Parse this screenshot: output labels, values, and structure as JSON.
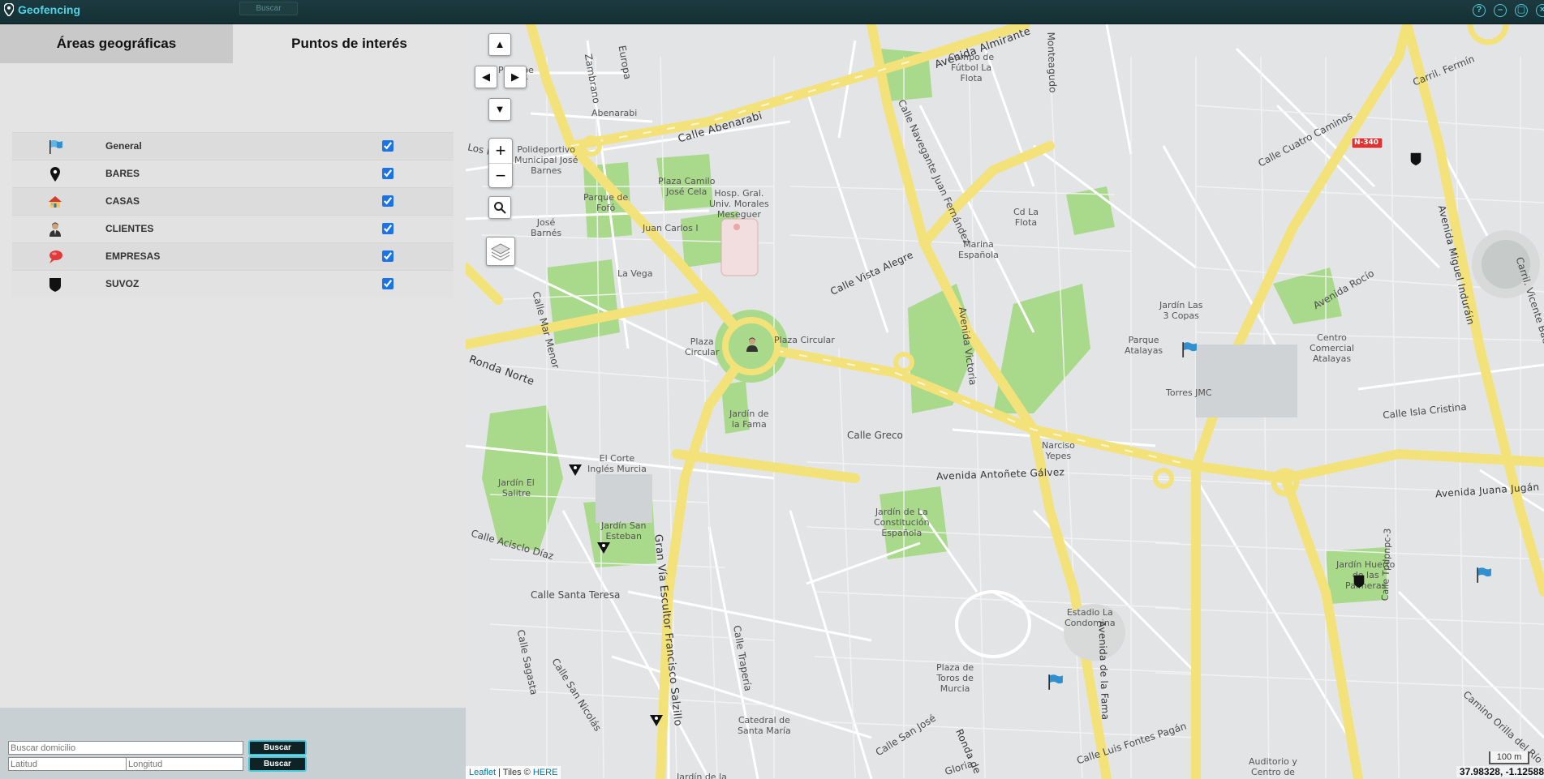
{
  "window": {
    "title": "Geofencing",
    "ghost_search_label": "Buscar",
    "controls": [
      "help-icon",
      "minimize-icon",
      "maximize-icon",
      "close-icon"
    ]
  },
  "tabs": [
    {
      "label": "Áreas geográficas",
      "active": false
    },
    {
      "label": "Puntos de interés",
      "active": true
    }
  ],
  "poi_categories": [
    {
      "label": "General",
      "icon": "blue-flag-icon",
      "checked": true
    },
    {
      "label": "BARES",
      "icon": "black-pin-icon",
      "checked": true
    },
    {
      "label": "CASAS",
      "icon": "house-icon",
      "checked": true
    },
    {
      "label": "CLIENTES",
      "icon": "person-icon",
      "checked": true
    },
    {
      "label": "EMPRESAS",
      "icon": "red-speech-bubble-icon",
      "checked": true
    },
    {
      "label": "SUVOZ",
      "icon": "black-shield-icon",
      "checked": true
    }
  ],
  "search": {
    "address_placeholder": "Buscar domicilio",
    "lat_placeholder": "Latitud",
    "lng_placeholder": "Longitud",
    "button_label": "Buscar"
  },
  "map": {
    "attribution_leaflet": "Leaflet",
    "attribution_tiles": " | Tiles © ",
    "attribution_provider": "HERE",
    "scale_label": "100 m",
    "coordinates": "37.98328, -1.12588",
    "shield_label": "N-340",
    "labels": {
      "avenida_almirante": "Avenida Almirante",
      "calle_abenarabi": "Calle Abenarabi",
      "abenarabi": "Abenarabi",
      "campo_futbol": "Campo de\nFútbol La\nFlota",
      "polideportivo": "Polideportivo\nMunicipal José\nBarnes",
      "parque_fofo": "Parque de\nFofó",
      "plaza_camilo": "Plaza Camilo\nJosé Cela",
      "hosp": "Hosp. Gral.\nUniv. Morales\nMeseguer",
      "jose_barnes": "José\nBarnés",
      "juan_carlos": "Juan Carlos I",
      "la_vega": "La Vega",
      "calle_vista_alegre": "Calle Vista Alegre",
      "marina_espanola": "Marina\nEspañola",
      "cd_la_flota": "Cd La\nFlota",
      "calle_navegante": "Calle Navegante Juan Fernández",
      "calle_cuatro_caminos": "Calle Cuatro Caminos",
      "jardin_las_3_copas": "Jardín Las\n3 Copas",
      "parque_atalayas": "Parque\nAtalayas",
      "torres_jmc": "Torres JMC",
      "avenida_rocio": "Avenida Rocío",
      "centro_comercial": "Centro\nComercial\nAtalayas",
      "calle_isla_cristina": "Calle Isla Cristina",
      "avenida_miguel_indurain": "Avenida Miguel Induráin",
      "ronda_norte": "Ronda Norte",
      "plaza_circular_label": "Plaza Circular",
      "plaza_circular_park": "Plaza\nCircular",
      "jardin_fama": "Jardín de\nla Fama",
      "calle_greco": "Calle Greco",
      "avenida_antonete": "Avenida Antoñete Gálvez",
      "narciso_yepes": "Narciso\nYepes",
      "el_corte_ingles": "El Corte\nInglés Murcia",
      "jardin_el_salitre": "Jardín El\nSalitre",
      "jardin_san_esteban": "Jardín San\nEsteban",
      "gran_via": "Gran Vía Escultor Francisco Salzillo",
      "calle_acisclo_diaz": "Calle Acisclo Díaz",
      "calle_santa_teresa": "Calle Santa Teresa",
      "jardin_constitucion": "Jardín de La\nConstitución\nEspañola",
      "avenida_juana_jugan": "Avenida Juana Jugán",
      "jardin_huerto": "Jardín Huerto\nde las\nPalmeras",
      "estadio": "Estadio La\nCondomina",
      "avenida_fama": "Avenida de la Fama",
      "plaza_toros": "Plaza de\nToros de\nMurcia",
      "calle_trapería": "Calle Trapería",
      "catedral": "Catedral de\nSanta María",
      "calle_sagasta": "Calle Sagasta",
      "calle_san_nicolas": "Calle San Nicolás",
      "calle_san_jose": "Calle San José",
      "ronda_de": "Ronda de",
      "calle_luis_fontes": "Calle Luis Fontes Pagán",
      "auditorio": "Auditorio y\nCentro de",
      "camino_orilla": "Camino Orilla del Río",
      "calle_mar_menor": "Calle Mar Menor",
      "calle_zambrano": "Zambrano",
      "calle_europa": "Europa",
      "calle_monteagudo": "Monteagudo",
      "avenida_victoria": "Avenida Victoria",
      "carril_fermin": "Carril. Fermín",
      "carril_vicente": "Carril. Vicente Baeza",
      "ronda_pinos": "Los Pinos",
      "calle_1": "Calle Tpdpnpc-3",
      "gloria": "Gloria",
      "jardin_de_la": "Jardín de la",
      "principe": "Príncipe\nAstur"
    }
  }
}
